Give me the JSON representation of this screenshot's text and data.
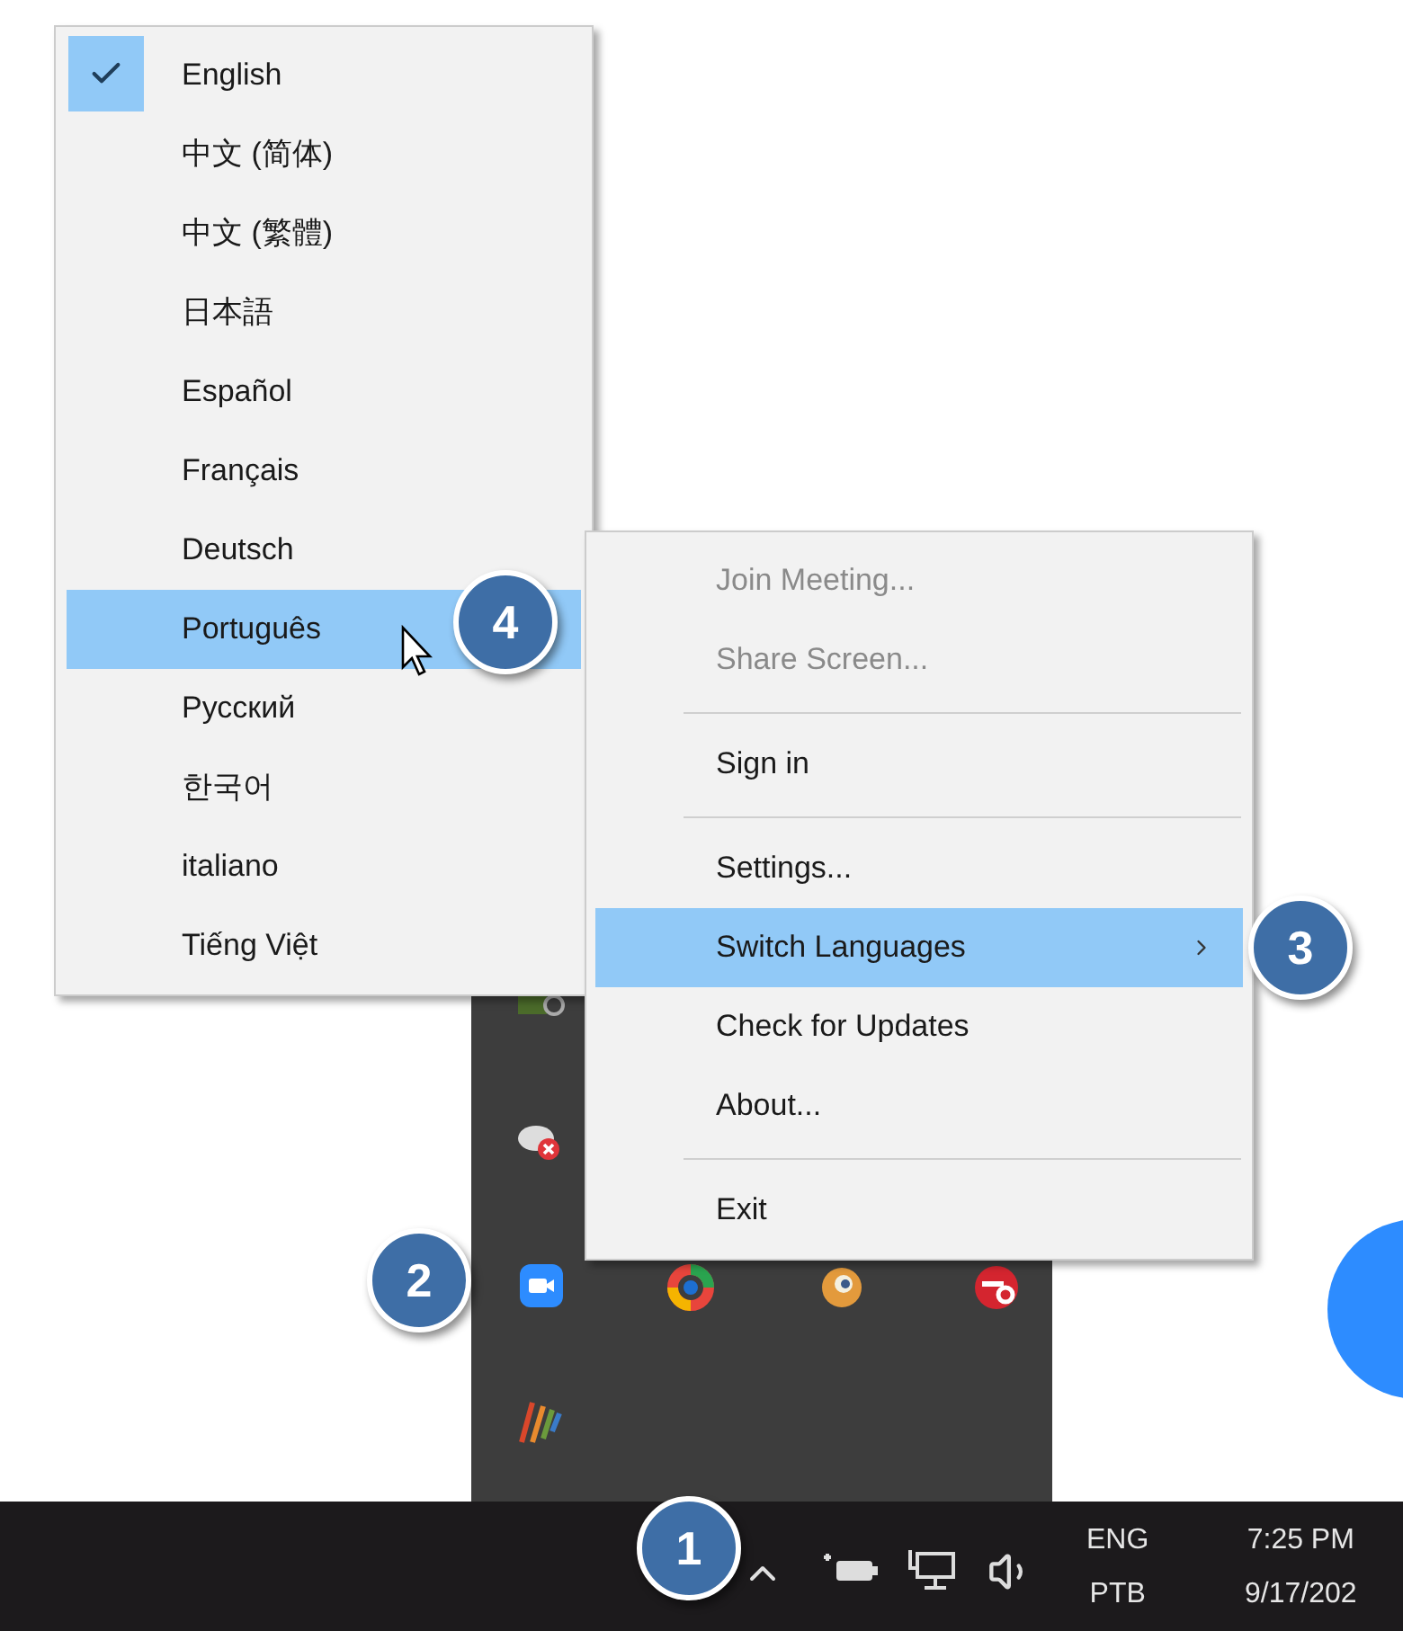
{
  "language_menu": {
    "items": [
      {
        "label": "English",
        "checked": true,
        "selected": false
      },
      {
        "label": "中文 (简体)",
        "checked": false,
        "selected": false
      },
      {
        "label": "中文 (繁體)",
        "checked": false,
        "selected": false
      },
      {
        "label": "日本語",
        "checked": false,
        "selected": false
      },
      {
        "label": "Español",
        "checked": false,
        "selected": false
      },
      {
        "label": "Français",
        "checked": false,
        "selected": false
      },
      {
        "label": "Deutsch",
        "checked": false,
        "selected": false
      },
      {
        "label": "Português",
        "checked": false,
        "selected": true
      },
      {
        "label": "Русский",
        "checked": false,
        "selected": false
      },
      {
        "label": "한국어",
        "checked": false,
        "selected": false
      },
      {
        "label": "italiano",
        "checked": false,
        "selected": false
      },
      {
        "label": "Tiếng Việt",
        "checked": false,
        "selected": false
      }
    ]
  },
  "context_menu": {
    "items": [
      {
        "kind": "item",
        "label": "Join Meeting...",
        "disabled": true,
        "selected": false,
        "submenu": false
      },
      {
        "kind": "item",
        "label": "Share Screen...",
        "disabled": true,
        "selected": false,
        "submenu": false
      },
      {
        "kind": "separator"
      },
      {
        "kind": "item",
        "label": "Sign in",
        "disabled": false,
        "selected": false,
        "submenu": false
      },
      {
        "kind": "separator"
      },
      {
        "kind": "item",
        "label": "Settings...",
        "disabled": false,
        "selected": false,
        "submenu": false
      },
      {
        "kind": "item",
        "label": "Switch Languages",
        "disabled": false,
        "selected": true,
        "submenu": true
      },
      {
        "kind": "item",
        "label": "Check for Updates",
        "disabled": false,
        "selected": false,
        "submenu": false
      },
      {
        "kind": "item",
        "label": "About...",
        "disabled": false,
        "selected": false,
        "submenu": false
      },
      {
        "kind": "separator"
      },
      {
        "kind": "item",
        "label": "Exit",
        "disabled": false,
        "selected": false,
        "submenu": false
      }
    ]
  },
  "taskbar": {
    "input_language": [
      "ENG",
      "PTB"
    ],
    "time": "7:25 PM",
    "date": "9/17/202"
  },
  "callouts": [
    {
      "label": "1"
    },
    {
      "label": "2"
    },
    {
      "label": "3"
    },
    {
      "label": "4"
    }
  ]
}
